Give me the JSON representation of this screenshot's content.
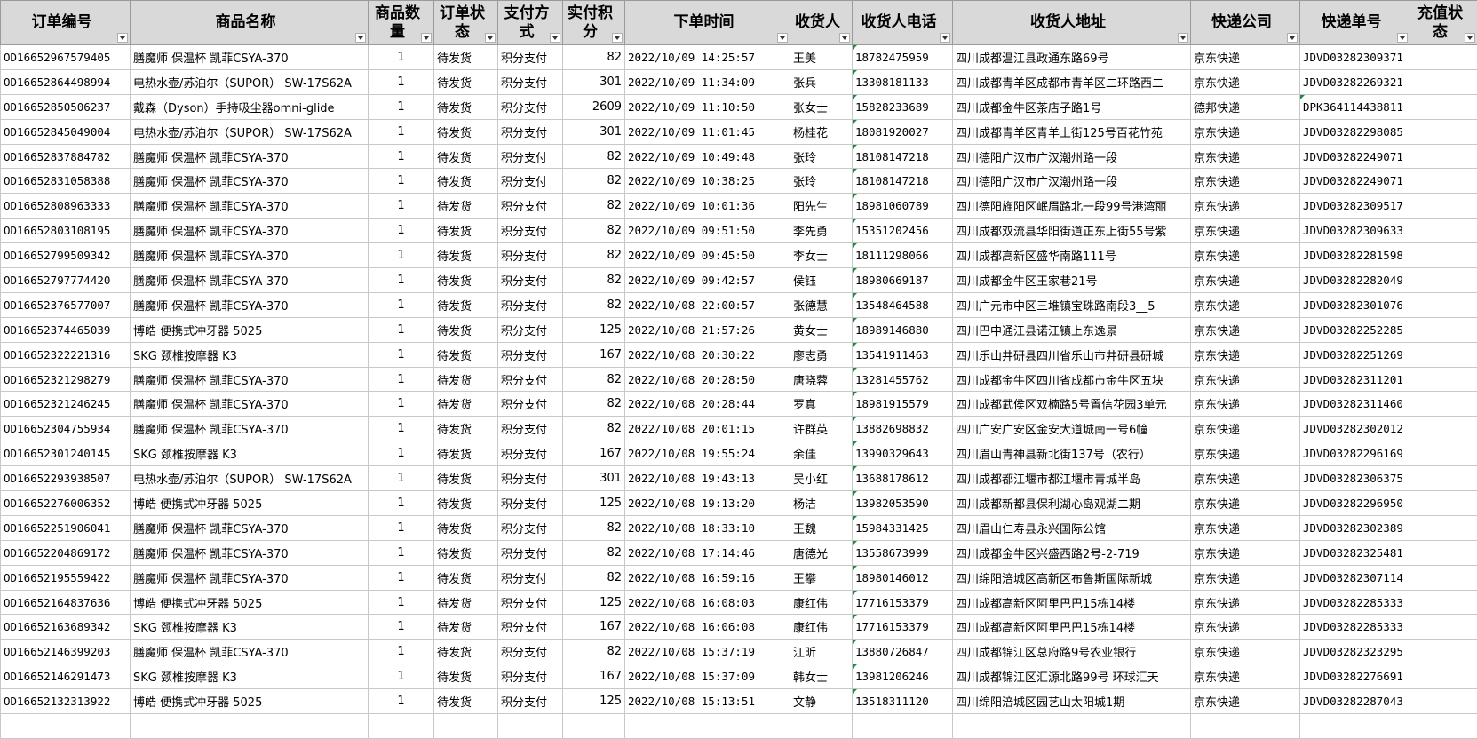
{
  "columns": [
    {
      "key": "order_id",
      "label": "订单编号"
    },
    {
      "key": "product",
      "label": "商品名称"
    },
    {
      "key": "qty",
      "label": "商品数量"
    },
    {
      "key": "status",
      "label": "订单状态"
    },
    {
      "key": "pay_method",
      "label": "支付方式"
    },
    {
      "key": "points",
      "label": "实付积分"
    },
    {
      "key": "order_time",
      "label": "下单时间"
    },
    {
      "key": "receiver",
      "label": "收货人"
    },
    {
      "key": "phone",
      "label": "收货人电话"
    },
    {
      "key": "address",
      "label": "收货人地址"
    },
    {
      "key": "express",
      "label": "快递公司"
    },
    {
      "key": "express_no",
      "label": "快递单号"
    },
    {
      "key": "recharge_status",
      "label": "充值状态"
    }
  ],
  "rows": [
    {
      "order_id": "OD16652967579405",
      "product": "膳魔师 保温杯 凯菲CSYA-370",
      "qty": "1",
      "status": "待发货",
      "pay_method": "积分支付",
      "points": "82",
      "order_time": "2022/10/09 14:25:57",
      "receiver": "王美",
      "phone": "18782475959",
      "address": "四川成都温江县政通东路69号",
      "express": "京东快递",
      "express_no": "JDVD03282309371",
      "recharge_status": ""
    },
    {
      "order_id": "OD16652864498994",
      "product": "电热水壶/苏泊尔（SUPOR） SW-17S62A",
      "qty": "1",
      "status": "待发货",
      "pay_method": "积分支付",
      "points": "301",
      "order_time": "2022/10/09 11:34:09",
      "receiver": "张兵",
      "phone": "13308181133",
      "address": "四川成都青羊区成都市青羊区二环路西二",
      "express": "京东快递",
      "express_no": "JDVD03282269321",
      "recharge_status": ""
    },
    {
      "order_id": "OD16652850506237",
      "product": "戴森（Dyson）手持吸尘器omni-glide",
      "qty": "1",
      "status": "待发货",
      "pay_method": "积分支付",
      "points": "2609",
      "order_time": "2022/10/09 11:10:50",
      "receiver": "张女士",
      "phone": "15828233689",
      "address": "四川成都金牛区茶店子路1号",
      "express": "德邦快递",
      "express_no": "DPK364114438811",
      "recharge_status": ""
    },
    {
      "order_id": "OD16652845049004",
      "product": "电热水壶/苏泊尔（SUPOR） SW-17S62A",
      "qty": "1",
      "status": "待发货",
      "pay_method": "积分支付",
      "points": "301",
      "order_time": "2022/10/09 11:01:45",
      "receiver": "杨桂花",
      "phone": "18081920027",
      "address": "四川成都青羊区青羊上街125号百花竹苑",
      "express": "京东快递",
      "express_no": "JDVD03282298085",
      "recharge_status": ""
    },
    {
      "order_id": "OD16652837884782",
      "product": "膳魔师 保温杯 凯菲CSYA-370",
      "qty": "1",
      "status": "待发货",
      "pay_method": "积分支付",
      "points": "82",
      "order_time": "2022/10/09 10:49:48",
      "receiver": "张玲",
      "phone": "18108147218",
      "address": "四川德阳广汉市广汉潮州路一段",
      "express": "京东快递",
      "express_no": "JDVD03282249071",
      "recharge_status": ""
    },
    {
      "order_id": "OD16652831058388",
      "product": "膳魔师 保温杯 凯菲CSYA-370",
      "qty": "1",
      "status": "待发货",
      "pay_method": "积分支付",
      "points": "82",
      "order_time": "2022/10/09 10:38:25",
      "receiver": "张玲",
      "phone": "18108147218",
      "address": "四川德阳广汉市广汉潮州路一段",
      "express": "京东快递",
      "express_no": "JDVD03282249071",
      "recharge_status": ""
    },
    {
      "order_id": "OD16652808963333",
      "product": "膳魔师 保温杯 凯菲CSYA-370",
      "qty": "1",
      "status": "待发货",
      "pay_method": "积分支付",
      "points": "82",
      "order_time": "2022/10/09 10:01:36",
      "receiver": "阳先生",
      "phone": "18981060789",
      "address": "四川德阳旌阳区岷眉路北一段99号港湾丽",
      "express": "京东快递",
      "express_no": "JDVD03282309517",
      "recharge_status": ""
    },
    {
      "order_id": "OD16652803108195",
      "product": "膳魔师 保温杯 凯菲CSYA-370",
      "qty": "1",
      "status": "待发货",
      "pay_method": "积分支付",
      "points": "82",
      "order_time": "2022/10/09 09:51:50",
      "receiver": "李先勇",
      "phone": "15351202456",
      "address": "四川成都双流县华阳街道正东上街55号紫",
      "express": "京东快递",
      "express_no": "JDVD03282309633",
      "recharge_status": ""
    },
    {
      "order_id": "OD16652799509342",
      "product": "膳魔师 保温杯 凯菲CSYA-370",
      "qty": "1",
      "status": "待发货",
      "pay_method": "积分支付",
      "points": "82",
      "order_time": "2022/10/09 09:45:50",
      "receiver": "李女士",
      "phone": "18111298066",
      "address": "四川成都高新区盛华南路111号",
      "express": "京东快递",
      "express_no": "JDVD03282281598",
      "recharge_status": ""
    },
    {
      "order_id": "OD16652797774420",
      "product": "膳魔师 保温杯 凯菲CSYA-370",
      "qty": "1",
      "status": "待发货",
      "pay_method": "积分支付",
      "points": "82",
      "order_time": "2022/10/09 09:42:57",
      "receiver": "侯钰",
      "phone": "18980669187",
      "address": "四川成都金牛区王家巷21号",
      "express": "京东快递",
      "express_no": "JDVD03282282049",
      "recharge_status": ""
    },
    {
      "order_id": "OD16652376577007",
      "product": "膳魔师 保温杯 凯菲CSYA-370",
      "qty": "1",
      "status": "待发货",
      "pay_method": "积分支付",
      "points": "82",
      "order_time": "2022/10/08 22:00:57",
      "receiver": "张德慧",
      "phone": "13548464588",
      "address": "四川广元市中区三堆镇宝珠路南段3__5",
      "express": "京东快递",
      "express_no": "JDVD03282301076",
      "recharge_status": ""
    },
    {
      "order_id": "OD16652374465039",
      "product": "博皓 便携式冲牙器 5025",
      "qty": "1",
      "status": "待发货",
      "pay_method": "积分支付",
      "points": "125",
      "order_time": "2022/10/08 21:57:26",
      "receiver": "黄女士",
      "phone": "18989146880",
      "address": "四川巴中通江县诺江镇上东逸景",
      "express": "京东快递",
      "express_no": "JDVD03282252285",
      "recharge_status": ""
    },
    {
      "order_id": "OD16652322221316",
      "product": "SKG 颈椎按摩器 K3",
      "qty": "1",
      "status": "待发货",
      "pay_method": "积分支付",
      "points": "167",
      "order_time": "2022/10/08 20:30:22",
      "receiver": "廖志勇",
      "phone": "13541911463",
      "address": "四川乐山井研县四川省乐山市井研县研城",
      "express": "京东快递",
      "express_no": "JDVD03282251269",
      "recharge_status": ""
    },
    {
      "order_id": "OD16652321298279",
      "product": "膳魔师 保温杯 凯菲CSYA-370",
      "qty": "1",
      "status": "待发货",
      "pay_method": "积分支付",
      "points": "82",
      "order_time": "2022/10/08 20:28:50",
      "receiver": "唐晓蓉",
      "phone": "13281455762",
      "address": "四川成都金牛区四川省成都市金牛区五块",
      "express": "京东快递",
      "express_no": "JDVD03282311201",
      "recharge_status": ""
    },
    {
      "order_id": "OD16652321246245",
      "product": "膳魔师 保温杯 凯菲CSYA-370",
      "qty": "1",
      "status": "待发货",
      "pay_method": "积分支付",
      "points": "82",
      "order_time": "2022/10/08 20:28:44",
      "receiver": "罗真",
      "phone": "18981915579",
      "address": "四川成都武侯区双楠路5号置信花园3单元",
      "express": "京东快递",
      "express_no": "JDVD03282311460",
      "recharge_status": ""
    },
    {
      "order_id": "OD16652304755934",
      "product": "膳魔师 保温杯 凯菲CSYA-370",
      "qty": "1",
      "status": "待发货",
      "pay_method": "积分支付",
      "points": "82",
      "order_time": "2022/10/08 20:01:15",
      "receiver": "许群英",
      "phone": "13882698832",
      "address": "四川广安广安区金安大道城南一号6幢",
      "express": "京东快递",
      "express_no": "JDVD03282302012",
      "recharge_status": ""
    },
    {
      "order_id": "OD16652301240145",
      "product": "SKG 颈椎按摩器 K3",
      "qty": "1",
      "status": "待发货",
      "pay_method": "积分支付",
      "points": "167",
      "order_time": "2022/10/08 19:55:24",
      "receiver": "余佳",
      "phone": "13990329643",
      "address": "四川眉山青神县新北街137号（农行）",
      "express": "京东快递",
      "express_no": "JDVD03282296169",
      "recharge_status": ""
    },
    {
      "order_id": "OD16652293938507",
      "product": "电热水壶/苏泊尔（SUPOR） SW-17S62A",
      "qty": "1",
      "status": "待发货",
      "pay_method": "积分支付",
      "points": "301",
      "order_time": "2022/10/08 19:43:13",
      "receiver": "吴小红",
      "phone": "13688178612",
      "address": "四川成都都江堰市都江堰市青城半岛",
      "express": "京东快递",
      "express_no": "JDVD03282306375",
      "recharge_status": ""
    },
    {
      "order_id": "OD16652276006352",
      "product": "博皓 便携式冲牙器 5025",
      "qty": "1",
      "status": "待发货",
      "pay_method": "积分支付",
      "points": "125",
      "order_time": "2022/10/08 19:13:20",
      "receiver": "杨洁",
      "phone": "13982053590",
      "address": "四川成都新都县保利湖心岛观湖二期",
      "express": "京东快递",
      "express_no": "JDVD03282296950",
      "recharge_status": ""
    },
    {
      "order_id": "OD16652251906041",
      "product": "膳魔师 保温杯 凯菲CSYA-370",
      "qty": "1",
      "status": "待发货",
      "pay_method": "积分支付",
      "points": "82",
      "order_time": "2022/10/08 18:33:10",
      "receiver": "王魏",
      "phone": "15984331425",
      "address": "四川眉山仁寿县永兴国际公馆",
      "express": "京东快递",
      "express_no": "JDVD03282302389",
      "recharge_status": ""
    },
    {
      "order_id": "OD16652204869172",
      "product": "膳魔师 保温杯 凯菲CSYA-370",
      "qty": "1",
      "status": "待发货",
      "pay_method": "积分支付",
      "points": "82",
      "order_time": "2022/10/08 17:14:46",
      "receiver": "唐德光",
      "phone": "13558673999",
      "address": "四川成都金牛区兴盛西路2号-2-719",
      "express": "京东快递",
      "express_no": "JDVD03282325481",
      "recharge_status": ""
    },
    {
      "order_id": "OD16652195559422",
      "product": "膳魔师 保温杯 凯菲CSYA-370",
      "qty": "1",
      "status": "待发货",
      "pay_method": "积分支付",
      "points": "82",
      "order_time": "2022/10/08 16:59:16",
      "receiver": "王攀",
      "phone": "18980146012",
      "address": "四川绵阳涪城区高新区布鲁斯国际新城",
      "express": "京东快递",
      "express_no": "JDVD03282307114",
      "recharge_status": ""
    },
    {
      "order_id": "OD16652164837636",
      "product": "博皓 便携式冲牙器 5025",
      "qty": "1",
      "status": "待发货",
      "pay_method": "积分支付",
      "points": "125",
      "order_time": "2022/10/08 16:08:03",
      "receiver": "康红伟",
      "phone": "17716153379",
      "address": "四川成都高新区阿里巴巴15栋14楼",
      "express": "京东快递",
      "express_no": "JDVD03282285333",
      "recharge_status": ""
    },
    {
      "order_id": "OD16652163689342",
      "product": "SKG 颈椎按摩器 K3",
      "qty": "1",
      "status": "待发货",
      "pay_method": "积分支付",
      "points": "167",
      "order_time": "2022/10/08 16:06:08",
      "receiver": "康红伟",
      "phone": "17716153379",
      "address": "四川成都高新区阿里巴巴15栋14楼",
      "express": "京东快递",
      "express_no": "JDVD03282285333",
      "recharge_status": ""
    },
    {
      "order_id": "OD16652146399203",
      "product": "膳魔师 保温杯 凯菲CSYA-370",
      "qty": "1",
      "status": "待发货",
      "pay_method": "积分支付",
      "points": "82",
      "order_time": "2022/10/08 15:37:19",
      "receiver": "江昕",
      "phone": "13880726847",
      "address": "四川成都锦江区总府路9号农业银行",
      "express": "京东快递",
      "express_no": "JDVD03282323295",
      "recharge_status": ""
    },
    {
      "order_id": "OD16652146291473",
      "product": "SKG 颈椎按摩器 K3",
      "qty": "1",
      "status": "待发货",
      "pay_method": "积分支付",
      "points": "167",
      "order_time": "2022/10/08 15:37:09",
      "receiver": "韩女士",
      "phone": "13981206246",
      "address": "四川成都锦江区汇源北路99号 环球汇天",
      "express": "京东快递",
      "express_no": "JDVD03282276691",
      "recharge_status": ""
    },
    {
      "order_id": "OD16652132313922",
      "product": "博皓 便携式冲牙器 5025",
      "qty": "1",
      "status": "待发货",
      "pay_method": "积分支付",
      "points": "125",
      "order_time": "2022/10/08 15:13:51",
      "receiver": "文静",
      "phone": "13518311120",
      "address": "四川绵阳涪城区园艺山太阳城1期",
      "express": "京东快递",
      "express_no": "JDVD03282287043",
      "recharge_status": ""
    }
  ]
}
